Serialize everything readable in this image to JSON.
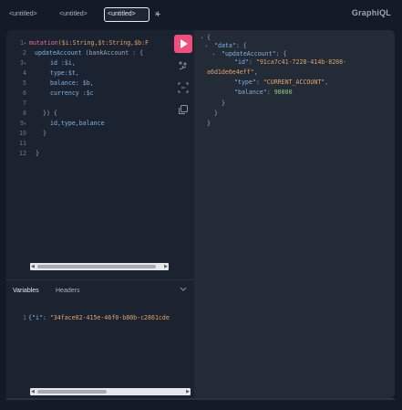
{
  "tabs": [
    {
      "label": "<untitled>"
    },
    {
      "label": "<untitled>"
    },
    {
      "label": "<untitled>",
      "active": true
    }
  ],
  "tab_close": "×",
  "tab_add": "+",
  "logo": "GraphiQL",
  "editor": {
    "lines": [
      {
        "n": "1",
        "fold": "▾"
      },
      {
        "n": "2",
        "fold": ""
      },
      {
        "n": "3",
        "fold": "▾"
      },
      {
        "n": "4",
        "fold": ""
      },
      {
        "n": "5",
        "fold": ""
      },
      {
        "n": "6",
        "fold": ""
      },
      {
        "n": "7",
        "fold": ""
      },
      {
        "n": "8",
        "fold": ""
      },
      {
        "n": "9",
        "fold": "▾"
      },
      {
        "n": "10",
        "fold": ""
      },
      {
        "n": "11",
        "fold": ""
      },
      {
        "n": "12",
        "fold": ""
      }
    ],
    "code": {
      "l1_kw": "mutation",
      "l1_rest": "($i:String,$t:String,$b:F",
      "l2_fn": "updateAccount",
      "l2_rest": " (bankAccount : {",
      "l4": "id :$i,",
      "l5": "type:$t,",
      "l6": "balance: $b,",
      "l7": "currency :$c",
      "l9": "}) {",
      "l10": "id,type,balance",
      "l11": "}",
      "l13": "}"
    }
  },
  "variables": {
    "tab_variables": "Variables",
    "tab_headers": "Headers",
    "chevron": "⌄",
    "line_number": "1",
    "content_prefix": "{\"i\": ",
    "content_value": "\"34face02-415e-46f0-b80b-c2861cde"
  },
  "result": {
    "l1": "{",
    "l2_key": "\"data\"",
    "l2_rest": ": {",
    "l3_key": "\"updateAccount\"",
    "l3_rest": ": {",
    "l4_key": "\"id\"",
    "l4_val": "\"91ca7c41-7228-414b-8208-",
    "l5_val": "a6d1de6e4eff\"",
    "l5_rest": ",",
    "l6_key": "\"type\"",
    "l6_val": "\"CURRENT_ACCOUNT\"",
    "l7_key": "\"balance\"",
    "l7_val": "90000",
    "l8": "}",
    "l9": "}",
    "l10": "}"
  }
}
